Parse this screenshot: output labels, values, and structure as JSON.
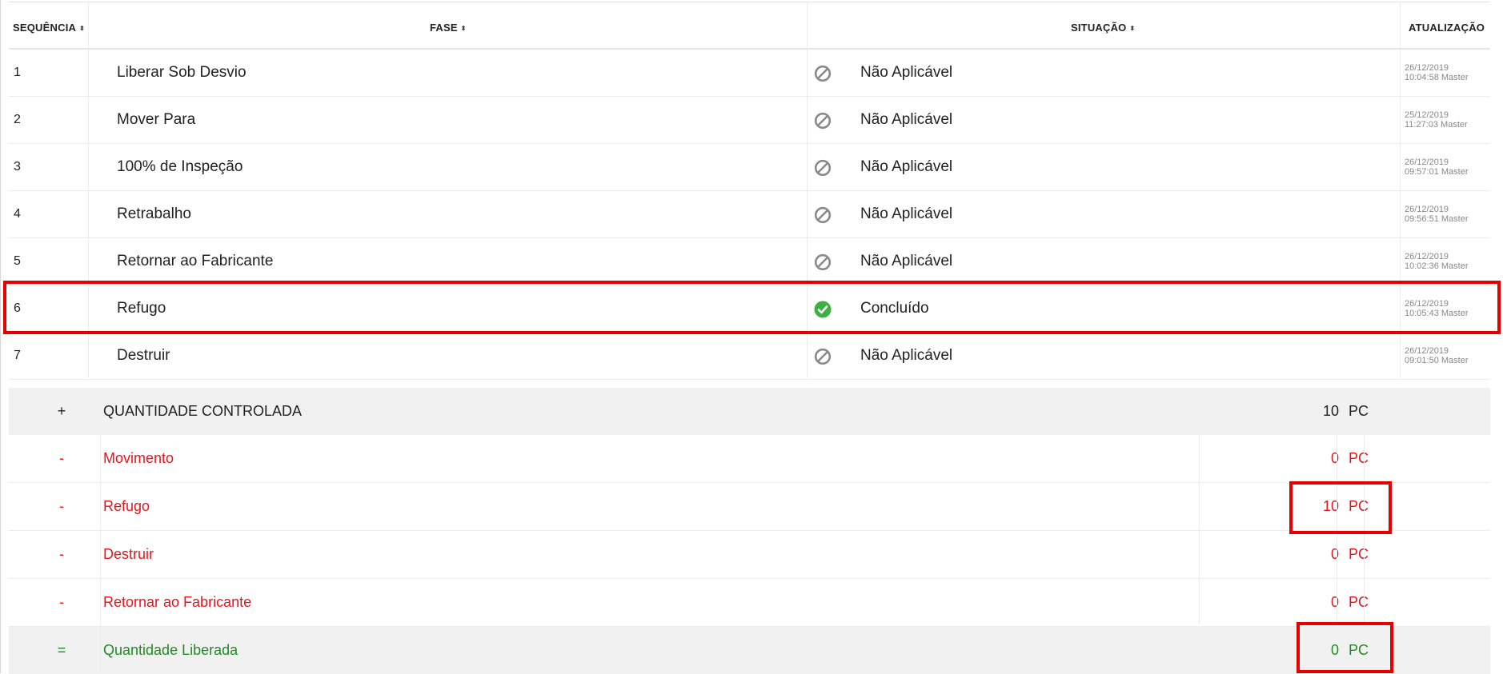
{
  "table": {
    "headers": {
      "sequence": "SEQUÊNCIA",
      "phase": "FASE",
      "status": "SITUAÇÃO",
      "updated": "ATUALIZAÇÃO"
    },
    "sort_glyph": "⬍",
    "rows": [
      {
        "seq": "1",
        "phase": "Liberar Sob Desvio",
        "status": "Não Aplicável",
        "status_icon": "blocked-icon",
        "date": "26/12/2019",
        "time_user": "10:04:58 Master"
      },
      {
        "seq": "2",
        "phase": "Mover Para",
        "status": "Não Aplicável",
        "status_icon": "blocked-icon",
        "date": "25/12/2019",
        "time_user": "11:27:03 Master"
      },
      {
        "seq": "3",
        "phase": "100% de Inspeção",
        "status": "Não Aplicável",
        "status_icon": "blocked-icon",
        "date": "26/12/2019",
        "time_user": "09:57:01 Master"
      },
      {
        "seq": "4",
        "phase": "Retrabalho",
        "status": "Não Aplicável",
        "status_icon": "blocked-icon",
        "date": "26/12/2019",
        "time_user": "09:56:51 Master"
      },
      {
        "seq": "5",
        "phase": "Retornar ao Fabricante",
        "status": "Não Aplicável",
        "status_icon": "blocked-icon",
        "date": "26/12/2019",
        "time_user": "10:02:36 Master"
      },
      {
        "seq": "6",
        "phase": "Refugo",
        "status": "Concluído",
        "status_icon": "check-circle-icon",
        "date": "26/12/2019",
        "time_user": "10:05:43 Master"
      },
      {
        "seq": "7",
        "phase": "Destruir",
        "status": "Não Aplicável",
        "status_icon": "blocked-icon",
        "date": "26/12/2019",
        "time_user": "09:01:50 Master"
      }
    ]
  },
  "quantities": [
    {
      "op": "+",
      "label": "QUANTIDADE CONTROLADA",
      "value": "10",
      "unit": "PC",
      "tone": "neutral"
    },
    {
      "op": "-",
      "label": "Movimento",
      "value": "0",
      "unit": "PC",
      "tone": "red"
    },
    {
      "op": "-",
      "label": "Refugo",
      "value": "10",
      "unit": "PC",
      "tone": "red"
    },
    {
      "op": "-",
      "label": "Destruir",
      "value": "0",
      "unit": "PC",
      "tone": "red"
    },
    {
      "op": "-",
      "label": "Retornar ao Fabricante",
      "value": "0",
      "unit": "PC",
      "tone": "red"
    },
    {
      "op": "=",
      "label": "Quantidade Liberada",
      "value": "0",
      "unit": "PC",
      "tone": "green"
    }
  ],
  "colors": {
    "red": "#e8141c",
    "green": "#1e8c1e",
    "neutral": "#222222",
    "blocked_icon": "#8a8a8a",
    "check_icon": "#3cb043",
    "highlight": "#e60000"
  }
}
